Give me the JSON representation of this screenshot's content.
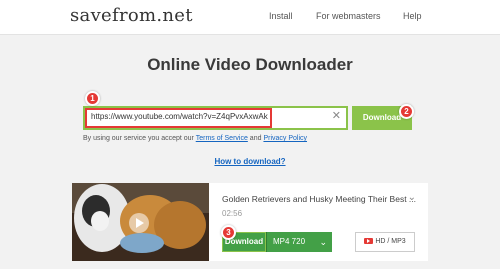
{
  "header": {
    "logo": "savefrom.net",
    "nav": [
      "Install",
      "For webmasters",
      "Help"
    ]
  },
  "main": {
    "title": "Online Video Downloader",
    "url_value": "https://www.youtube.com/watch?v=Z4qPvxAxwAk",
    "clear_symbol": "✕",
    "download_label": "Download",
    "terms_prefix": "By using our service you accept our",
    "terms_link": "Terms of Service",
    "terms_and": "and",
    "privacy_link": "Privacy Policy",
    "howto": "How to download?"
  },
  "badges": [
    "1",
    "2",
    "3"
  ],
  "result": {
    "title": "Golden Retrievers and Husky Meeting Their Best ...",
    "duration": "02:56",
    "download_label": "Download",
    "format": "MP4  720",
    "hd_label": "HD / MP3",
    "chevron_down": "⌄",
    "chevron_up": "⌃"
  },
  "colors": {
    "accent_green": "#8bc34a",
    "button_green": "#43a047",
    "badge_red": "#e53935",
    "link_blue": "#1565c0"
  }
}
